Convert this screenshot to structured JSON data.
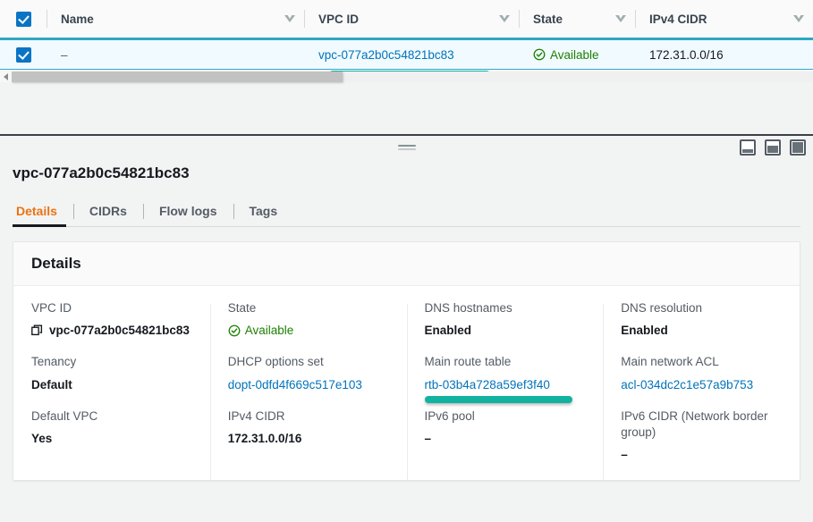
{
  "colors": {
    "link": "#0073bb",
    "accent_orange": "#ec7211",
    "status_green": "#1d8102",
    "marker_teal": "#11b3a0",
    "selected_row_bg": "#f1faff",
    "checkbox_blue": "#0a74c4"
  },
  "table": {
    "columns": [
      {
        "label": "Name",
        "sort_icon": "sort-descending-icon"
      },
      {
        "label": "VPC ID",
        "sort_icon": "sort-descending-icon"
      },
      {
        "label": "State",
        "sort_icon": "sort-descending-icon"
      },
      {
        "label": "IPv4 CIDR",
        "sort_icon": "sort-descending-icon"
      }
    ],
    "select_all_checked": true,
    "rows": [
      {
        "selected": true,
        "name": "–",
        "vpc_id": "vpc-077a2b0c54821bc83",
        "state": "Available",
        "state_icon": "check-circle-icon",
        "ipv4_cidr": "172.31.0.0/16",
        "highlighted": true
      }
    ],
    "scrollbar": {
      "left_arrow_icon": "chevron-left-icon"
    }
  },
  "split_panel": {
    "drag_handle_icon": "drag-handle-icon",
    "actions": [
      {
        "name": "panel-size-small",
        "icon": "panel-small-icon"
      },
      {
        "name": "panel-size-medium",
        "icon": "panel-medium-icon"
      },
      {
        "name": "panel-size-large",
        "icon": "panel-large-icon"
      }
    ],
    "title": "vpc-077a2b0c54821bc83",
    "tabs": [
      {
        "label": "Details",
        "active": true
      },
      {
        "label": "CIDRs",
        "active": false
      },
      {
        "label": "Flow logs",
        "active": false
      },
      {
        "label": "Tags",
        "active": false
      }
    ],
    "details": {
      "heading": "Details",
      "columns": [
        {
          "fields": [
            {
              "label": "VPC ID",
              "value": "vpc-077a2b0c54821bc83",
              "type": "copyable",
              "copy_icon": "copy-icon"
            },
            {
              "label": "Tenancy",
              "value": "Default",
              "type": "bold"
            },
            {
              "label": "Default VPC",
              "value": "Yes",
              "type": "bold"
            }
          ]
        },
        {
          "fields": [
            {
              "label": "State",
              "value": "Available",
              "type": "status",
              "status_icon": "check-circle-icon"
            },
            {
              "label": "DHCP options set",
              "value": "dopt-0dfd4f669c517e103",
              "type": "link"
            },
            {
              "label": "IPv4 CIDR",
              "value": "172.31.0.0/16",
              "type": "bold"
            }
          ]
        },
        {
          "fields": [
            {
              "label": "DNS hostnames",
              "value": "Enabled",
              "type": "bold"
            },
            {
              "label": "Main route table",
              "value": "rtb-03b4a728a59ef3f40",
              "type": "link",
              "highlighted": true
            },
            {
              "label": "IPv6 pool",
              "value": "–",
              "type": "bold"
            }
          ]
        },
        {
          "fields": [
            {
              "label": "DNS resolution",
              "value": "Enabled",
              "type": "bold"
            },
            {
              "label": "Main network ACL",
              "value": "acl-034dc2c1e57a9b753",
              "type": "link"
            },
            {
              "label": "IPv6 CIDR (Network border group)",
              "value": "–",
              "type": "bold"
            }
          ]
        }
      ]
    }
  }
}
